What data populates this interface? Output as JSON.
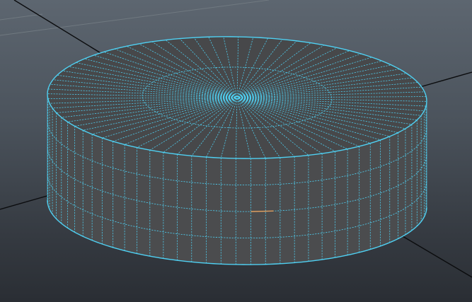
{
  "viewport": {
    "background_top": "#5d6670",
    "background_bottom": "#2a2e34",
    "grid_color": "#707980",
    "axis_color": "#0b0c0e"
  },
  "object": {
    "type": "polygon cylinder",
    "selection": "selected",
    "wireframe_color": "#4fd0f2",
    "top_color": "#47484a",
    "side_color": "#4b4c4e",
    "highlighted_edge_color": "#e1a060",
    "subdivisions_axis": 80,
    "subdivisions_cap": 2
  }
}
